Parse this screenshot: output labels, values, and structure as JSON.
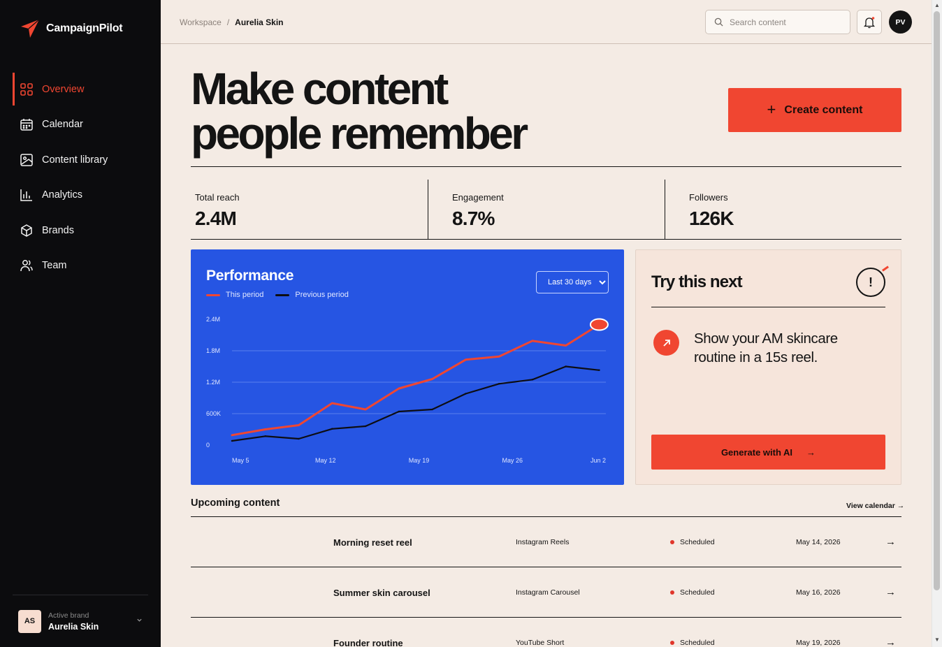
{
  "app": {
    "name": "CampaignPilot"
  },
  "sidebar": {
    "items": [
      {
        "label": "Overview",
        "icon": "grid-icon",
        "active": true
      },
      {
        "label": "Calendar",
        "icon": "calendar-icon"
      },
      {
        "label": "Content library",
        "icon": "image-icon"
      },
      {
        "label": "Analytics",
        "icon": "bar-chart-icon"
      },
      {
        "label": "Brands",
        "icon": "box-icon"
      },
      {
        "label": "Team",
        "icon": "users-icon"
      }
    ],
    "brand": {
      "caption": "Active brand",
      "name": "Aurelia Skin",
      "initials": "AS"
    }
  },
  "header": {
    "breadcrumb": [
      "Workspace",
      "/",
      "Aurelia Skin"
    ],
    "search_placeholder": "Search content",
    "user_initials": "PV"
  },
  "hero": {
    "title_line1": "Make content",
    "title_line2": "people remember",
    "create_label": "Create content"
  },
  "stats": [
    {
      "label": "Total reach",
      "value": "2.4M"
    },
    {
      "label": "Engagement",
      "value": "8.7%"
    },
    {
      "label": "Followers",
      "value": "126K"
    }
  ],
  "performance": {
    "title": "Performance",
    "range_options": [
      "Last 30 days"
    ],
    "range_selected": "Last 30 days"
  },
  "chart_data": {
    "type": "line",
    "title": "Performance",
    "y_ticks": [
      0,
      600000,
      1200000,
      1800000,
      2400000
    ],
    "y_tick_labels": [
      "0",
      "600K",
      "1.2M",
      "1.8M",
      "2.4M"
    ],
    "ylim": [
      0,
      2400000
    ],
    "x_tick_labels": [
      "May 5",
      "May 12",
      "May 19",
      "May 26",
      "Jun 2"
    ],
    "x_ticks_day": [
      0,
      7,
      14,
      21,
      28
    ],
    "grid": true,
    "legend": "top-left",
    "series": [
      {
        "name": "This period",
        "color": "#f04631",
        "x_day": [
          0,
          2.5,
          5,
          7.5,
          10,
          12.5,
          15,
          17.5,
          20,
          22.5,
          25,
          27.5
        ],
        "values": [
          190000,
          300000,
          380000,
          800000,
          680000,
          1080000,
          1260000,
          1630000,
          1690000,
          1990000,
          1900000,
          2300000
        ]
      },
      {
        "name": "Previous period",
        "color": "#0d0d12",
        "x_day": [
          0,
          2.5,
          5,
          7.5,
          10,
          12.5,
          15,
          17.5,
          20,
          22.5,
          25,
          27.5
        ],
        "values": [
          80000,
          170000,
          120000,
          310000,
          360000,
          640000,
          680000,
          980000,
          1170000,
          1250000,
          1500000,
          1430000
        ]
      }
    ]
  },
  "suggestion": {
    "title": "Try this next",
    "badge": "!",
    "text": "Show your AM skincare routine in a 15s reel.",
    "button_label": "Generate with AI",
    "button_arrow": "→"
  },
  "upcoming": {
    "title": "Upcoming content",
    "view_calendar": "View calendar →",
    "rows": [
      {
        "title": "Morning reset reel",
        "channel": "Instagram Reels",
        "status": "Scheduled",
        "date": "May 14, 2026"
      },
      {
        "title": "Summer skin carousel",
        "channel": "Instagram Carousel",
        "status": "Scheduled",
        "date": "May 16, 2026"
      },
      {
        "title": "Founder routine",
        "channel": "YouTube Short",
        "status": "Scheduled",
        "date": "May 19, 2026"
      }
    ]
  },
  "colors": {
    "accent": "#f04631",
    "chart_bg": "#2655e3",
    "sidebar_bg": "#0c0c0e",
    "page_bg": "#f4ebe4"
  }
}
